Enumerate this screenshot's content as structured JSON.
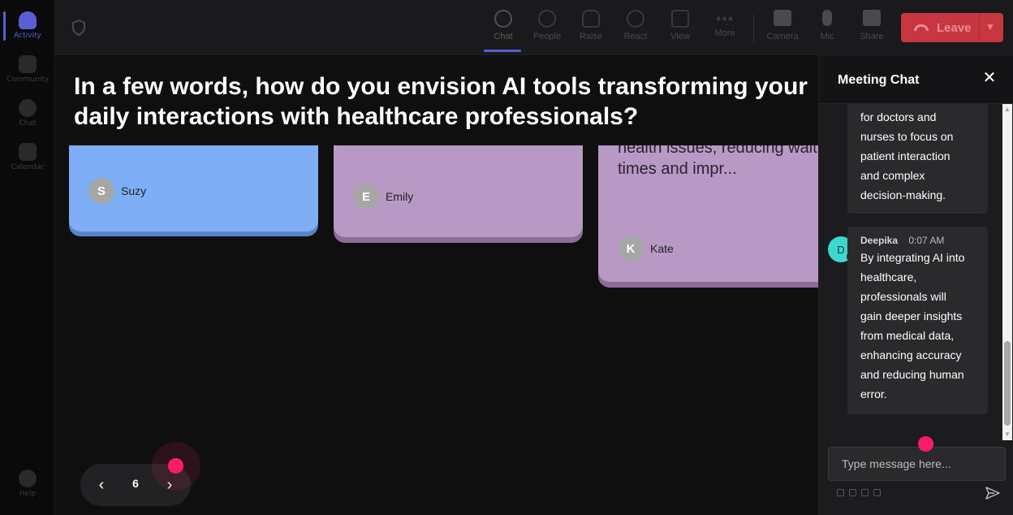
{
  "rail": {
    "items": [
      {
        "label": "Activity",
        "active": true
      },
      {
        "label": "Community"
      },
      {
        "label": "Chat"
      },
      {
        "label": "Calendar"
      }
    ],
    "help_label": "Help"
  },
  "toolbar": {
    "buttons": [
      {
        "label": "Chat",
        "icon": "chat-bubble-icon",
        "active": true
      },
      {
        "label": "People",
        "icon": "person-icon"
      },
      {
        "label": "Raise",
        "icon": "raise-hand-icon"
      },
      {
        "label": "React",
        "icon": "smiley-icon"
      },
      {
        "label": "View",
        "icon": "grid-icon"
      },
      {
        "label": "More",
        "icon": "more-dots-icon"
      },
      {
        "label": "Camera",
        "icon": "camera-off-icon"
      },
      {
        "label": "Mic",
        "icon": "mic-icon"
      },
      {
        "label": "Share",
        "icon": "share-icon"
      }
    ],
    "leave_label": "Leave",
    "leave_color": "#c8373f"
  },
  "stage": {
    "question": "In a few words, how do you envision AI tools transforming your daily interactions with healthcare professionals?",
    "cards": [
      {
        "author": "Suzy",
        "initial": "S",
        "color": "#7eaef6"
      },
      {
        "author": "Emily",
        "initial": "E",
        "color": "#b898c4"
      },
      {
        "author": "Kate",
        "initial": "K",
        "color": "#b898c4",
        "text_lines": [
          "health issues, reducing wait",
          "times and impr..."
        ]
      }
    ],
    "pager": {
      "page": "6"
    }
  },
  "chat": {
    "title": "Meeting Chat",
    "messages": [
      {
        "lines": [
          "for doctors and",
          "nurses to focus on",
          "patient interaction",
          "and complex",
          "decision-making."
        ]
      },
      {
        "author": "Deepika",
        "initial": "D",
        "time": "0:07 AM",
        "lines": [
          "By integrating AI into",
          "healthcare,",
          "professionals will",
          "gain deeper insights",
          "from medical data,",
          "enhancing accuracy",
          "and reducing human",
          "error."
        ]
      }
    ],
    "input_placeholder": "Type message here..."
  }
}
